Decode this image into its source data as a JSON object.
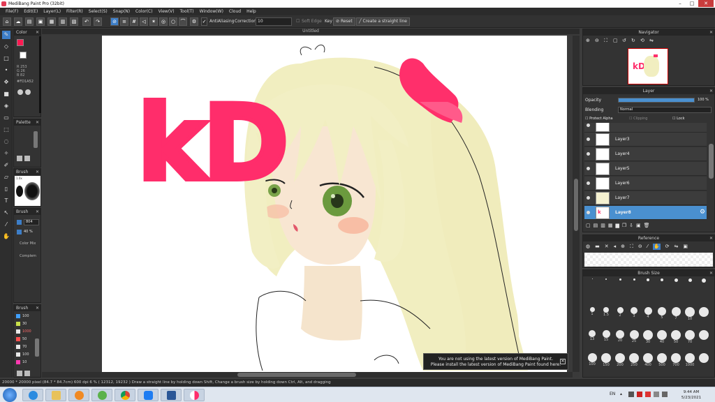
{
  "window": {
    "title": "MediBang Paint Pro (32bit)",
    "minimize": "–",
    "maximize": "□",
    "close": "✕"
  },
  "menu": [
    "File(F)",
    "Edit(E)",
    "Layer(L)",
    "Filter(R)",
    "Select(S)",
    "Snap(N)",
    "Color(C)",
    "View(V)",
    "Tool(T)",
    "Window(W)",
    "Cloud",
    "Help"
  ],
  "toolbar": {
    "antialiasing": "AntiAliasing",
    "correction_label": "Correction",
    "correction_value": "10",
    "soft_edge": "Soft Edge",
    "key_label": "Key",
    "reset": "Reset",
    "straight_line": "Create a straight line"
  },
  "document": {
    "tab_title": "Untitled",
    "drawn_text": "kD"
  },
  "color_panel": {
    "title": "Color",
    "r": "R 253",
    "g": "G 26",
    "b": "B 82",
    "hex": "#FD1A52",
    "primary": "#fd1a52",
    "secondary": "#ffffff"
  },
  "palette_panel": {
    "title": "Palette"
  },
  "brush_panel": {
    "title": "Brush",
    "size_label": "1.0x"
  },
  "brush_settings": {
    "title": "Brush",
    "size": "804",
    "opacity": "40 %",
    "items": [
      "Color Mix",
      "Complem"
    ]
  },
  "brush_list": {
    "title": "Brush",
    "sizes": [
      "100",
      "30",
      "1000",
      "50",
      "70",
      "100",
      "10"
    ],
    "colors": [
      "#40a0ff",
      "#c8e04a",
      "#e8e8e8",
      "#ff5050",
      "#e8e8e8",
      "#e8e8e8",
      "#ff3ab0"
    ]
  },
  "navigator": {
    "title": "Navigator"
  },
  "layer_panel": {
    "title": "Layer",
    "opacity_label": "Opacity",
    "opacity_value": "100 %",
    "opacity_fraction": 1.0,
    "blending_label": "Blending",
    "blending_value": "Normal",
    "protect_alpha": "Protect Alpha",
    "clipping": "Clipping",
    "lock": "Lock",
    "layers": [
      {
        "name": "Layer3"
      },
      {
        "name": "Layer4"
      },
      {
        "name": "Layer5"
      },
      {
        "name": "Layer6"
      },
      {
        "name": "Layer7"
      },
      {
        "name": "Layer8",
        "selected": true
      }
    ]
  },
  "reference_panel": {
    "title": "Reference"
  },
  "brush_size_panel": {
    "title": "Brush Size",
    "row1": [
      "",
      "",
      "",
      "",
      "",
      "",
      "",
      "",
      ""
    ],
    "row2": [
      "1",
      "1.5",
      "2",
      "3",
      "4",
      "5",
      "7",
      "10",
      ""
    ],
    "row3": [
      "13",
      "15",
      "20",
      "25",
      "30",
      "40",
      "50",
      "70",
      ""
    ],
    "row4": [
      "100",
      "150",
      "200",
      "250",
      "400",
      "500",
      "700",
      "1000",
      ""
    ]
  },
  "notice": {
    "line1": "You are not using the latest version of MediBang Paint.",
    "line2": "Please install the latest version of MediBang Paint found here."
  },
  "status": "20000 * 20000 pixel  (84.7 * 84.7cm)  600 dpi  6 %  ( 12312, 19232 )  Draw a straight line by holding down Shift, Change a brush size by holding down Ctrl, Alt, and dragging",
  "taskbar": {
    "lang": "EN",
    "time": "9:44 AM",
    "date": "5/23/2021",
    "apps": [
      "start",
      "ie",
      "explorer",
      "media",
      "greenapp",
      "chrome",
      "zalo",
      "word",
      "medibang"
    ]
  },
  "colors": {
    "accent": "#3d7ec8",
    "brand_pink": "#ff2d6b"
  }
}
